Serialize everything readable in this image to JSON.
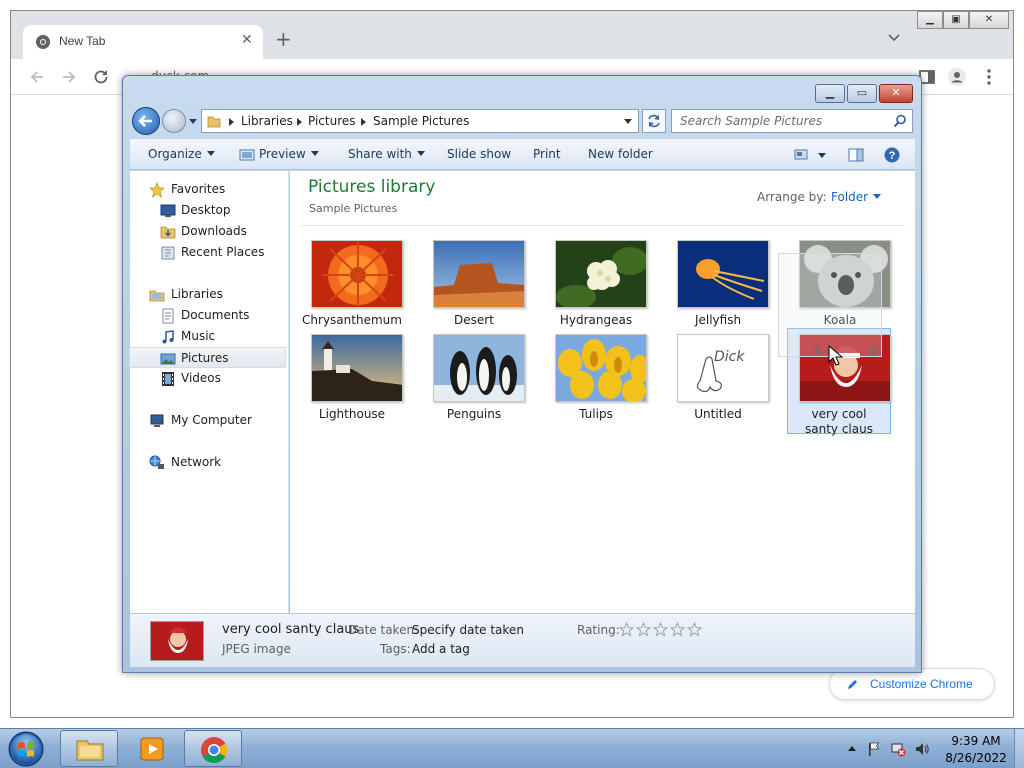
{
  "browser": {
    "tab_title": "New Tab",
    "omnibox_text": "duck.com",
    "customize_label": "Customize Chrome"
  },
  "explorer": {
    "breadcrumb": [
      "Libraries",
      "Pictures",
      "Sample Pictures"
    ],
    "search_placeholder": "Search Sample Pictures",
    "commands": {
      "organize": "Organize",
      "preview": "Preview",
      "share_with": "Share with",
      "slide_show": "Slide show",
      "print": "Print",
      "new_folder": "New folder"
    },
    "nav": {
      "favorites": "Favorites",
      "desktop": "Desktop",
      "downloads": "Downloads",
      "recent_places": "Recent Places",
      "libraries": "Libraries",
      "documents": "Documents",
      "music": "Music",
      "pictures": "Pictures",
      "videos": "Videos",
      "my_computer": "My Computer",
      "network": "Network"
    },
    "library_title": "Pictures library",
    "library_subtitle": "Sample Pictures",
    "arrange_label": "Arrange by:",
    "arrange_value": "Folder",
    "files": [
      {
        "name": "Chrysanthemum"
      },
      {
        "name": "Desert"
      },
      {
        "name": "Hydrangeas"
      },
      {
        "name": "Jellyfish"
      },
      {
        "name": "Koala"
      },
      {
        "name": "Lighthouse"
      },
      {
        "name": "Penguins"
      },
      {
        "name": "Tulips"
      },
      {
        "name": "Untitled"
      },
      {
        "name": "very cool santy claus"
      }
    ],
    "untitled_sketch_text": "Dick",
    "details": {
      "name": "very cool santy claus",
      "type": "JPEG image",
      "date_label": "Date taken:",
      "date_value": "Specify date taken",
      "tags_label": "Tags:",
      "tags_value": "Add a tag",
      "rating_label": "Rating:",
      "rating": 0
    }
  },
  "taskbar": {
    "time": "9:39 AM",
    "date": "8/26/2022"
  },
  "colors": {
    "library_title": "#1e7b2c",
    "link_blue": "#1565c0",
    "selection_bg": "#d9e8fb"
  }
}
